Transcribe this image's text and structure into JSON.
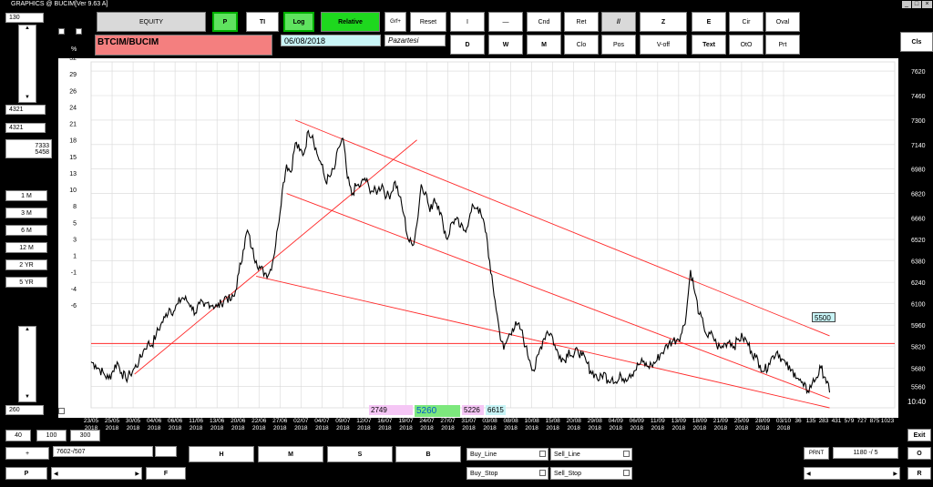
{
  "window": {
    "title": "GRAPHICS  @ BUCIM[Ver 9.63 A]",
    "minimize_glyph": "_",
    "maximize_glyph": "□",
    "close_glyph": "×"
  },
  "toolbar": {
    "equity": "EQUITY",
    "p": "P",
    "ti": "TI",
    "log": "Log",
    "relative": "Relative",
    "grf": "Grf+",
    "reset": "Reset",
    "i": "I",
    "line": "—",
    "cnd": "Cnd",
    "ret": "Ret",
    "parallel": "//",
    "z": "Z",
    "e": "E",
    "cir": "Cir",
    "oval": "Oval",
    "d": "D",
    "w": "W",
    "m": "M",
    "clo": "Clo",
    "pos": "Pos",
    "voff": "V-off",
    "text": "Text",
    "oho": "OtO",
    "prt": "Prt",
    "cls": "Cls"
  },
  "info": {
    "symbol": "BTCIM/BUCIM",
    "date": "06/08/2018",
    "day": "Pazartesi"
  },
  "left_panel": {
    "top_value": "130",
    "field1": "4321",
    "field2": "4321",
    "field3a": "7333",
    "field3b": "5458",
    "ranges": [
      "1 M",
      "3 M",
      "6 M",
      "12 M",
      "2 YR",
      "5 YR"
    ],
    "bottom_value": "260"
  },
  "bottom_controls": {
    "n40": "40",
    "n100": "100",
    "n300": "300",
    "plus": "+",
    "position": "7602-/507",
    "p": "P",
    "f": "F",
    "h": "H",
    "m": "M",
    "s": "S",
    "b": "B",
    "buy_line": "Buy_Line",
    "sell_line": "Sell_Line",
    "buy_stop": "Buy_Stop",
    "sell_stop": "Sell_Stop",
    "prnt": "PRNT",
    "ratio": "1180 -/ 5",
    "exit": "Exit",
    "o": "O",
    "r": "R",
    "time": "10:40"
  },
  "markers": {
    "m1": "2749",
    "m2": "5260",
    "m3": "5226",
    "m4": "6615",
    "price_tag": "5500"
  },
  "colors": {
    "pink_field": "#f47f7f",
    "cyan_field": "#c8f4f6",
    "green_button": "#1ed81e",
    "trend_lines": "#ff2a2a",
    "price_line": "#000000"
  },
  "chart_data": {
    "type": "line",
    "title": "",
    "xlabel": "",
    "ylabel": "",
    "left_axis_label": "%",
    "ylim": [
      5420,
      7680
    ],
    "y_ticks_right": [
      5560,
      5680,
      5820,
      5960,
      6100,
      6240,
      6380,
      6520,
      6660,
      6820,
      6980,
      7140,
      7300,
      7460,
      7620
    ],
    "y_ticks_left": [
      "32",
      "29",
      "26",
      "24",
      "21",
      "18",
      "15",
      "13",
      "10",
      "8",
      "5",
      "3",
      "1",
      "-1",
      "-4",
      "-6"
    ],
    "x_ticks": [
      "23/05 2018",
      "25/05 2018",
      "30/05 2018",
      "04/06 2018",
      "06/06 2018",
      "11/06 2018",
      "13/06 2018",
      "20/06 2018",
      "22/06 2018",
      "27/06 2018",
      "02/07 2018",
      "04/07 2018",
      "09/07 2018",
      "12/07 2018",
      "16/07 2018",
      "19/07 2018",
      "24/07 2018",
      "27/07 2018",
      "31/07 2018",
      "03/08 2018",
      "08/08 2018",
      "10/08 2018",
      "15/08 2018",
      "20/08 2018",
      "29/08 2018",
      "04/09 2018",
      "06/09 2018",
      "11/09 2018",
      "13/09 2018",
      "18/09 2018",
      "21/09 2018",
      "25/09 2018",
      "28/09 2018",
      "03/10 2018"
    ],
    "x_ticks_extra": [
      "36",
      "135",
      "283",
      "431",
      "579",
      "727",
      "875",
      "1023"
    ],
    "grid": true,
    "series": [
      {
        "values": [
          [
            0,
            5720
          ],
          [
            1,
            5700
          ],
          [
            2,
            5670
          ],
          [
            3,
            5640
          ],
          [
            4,
            5610
          ],
          [
            5,
            5660
          ],
          [
            6,
            5720
          ],
          [
            7,
            5650
          ],
          [
            8,
            5610
          ],
          [
            9,
            5640
          ],
          [
            10,
            5680
          ],
          [
            11,
            5720
          ],
          [
            12,
            5790
          ],
          [
            13,
            5840
          ],
          [
            14,
            5830
          ],
          [
            15,
            5900
          ],
          [
            16,
            5960
          ],
          [
            17,
            6010
          ],
          [
            18,
            6070
          ],
          [
            19,
            6050
          ],
          [
            20,
            6100
          ],
          [
            21,
            6140
          ],
          [
            22,
            6120
          ],
          [
            23,
            6090
          ],
          [
            24,
            6040
          ],
          [
            25,
            6100
          ],
          [
            26,
            6080
          ],
          [
            27,
            6110
          ],
          [
            28,
            6090
          ],
          [
            29,
            6080
          ],
          [
            30,
            6100
          ],
          [
            31,
            6150
          ],
          [
            32,
            6120
          ],
          [
            33,
            6150
          ],
          [
            34,
            6300
          ],
          [
            35,
            6450
          ],
          [
            36,
            6580
          ],
          [
            37,
            6460
          ],
          [
            38,
            6380
          ],
          [
            39,
            6330
          ],
          [
            40,
            6300
          ],
          [
            41,
            6300
          ],
          [
            42,
            6400
          ],
          [
            43,
            6600
          ],
          [
            44,
            6840
          ],
          [
            45,
            7010
          ],
          [
            46,
            6960
          ],
          [
            47,
            7150
          ],
          [
            48,
            7100
          ],
          [
            49,
            7080
          ],
          [
            50,
            7230
          ],
          [
            51,
            7200
          ],
          [
            52,
            7080
          ],
          [
            53,
            7010
          ],
          [
            54,
            6900
          ],
          [
            55,
            6930
          ],
          [
            56,
            6980
          ],
          [
            57,
            7120
          ],
          [
            58,
            7180
          ],
          [
            59,
            6920
          ],
          [
            60,
            6810
          ],
          [
            61,
            6870
          ],
          [
            62,
            6870
          ],
          [
            63,
            6920
          ],
          [
            64,
            6860
          ],
          [
            65,
            6830
          ],
          [
            66,
            6840
          ],
          [
            67,
            6880
          ],
          [
            68,
            6800
          ],
          [
            69,
            6820
          ],
          [
            70,
            6900
          ],
          [
            71,
            6800
          ],
          [
            72,
            6680
          ],
          [
            73,
            6520
          ],
          [
            74,
            6480
          ],
          [
            75,
            6620
          ],
          [
            76,
            6880
          ],
          [
            77,
            6830
          ],
          [
            78,
            6700
          ],
          [
            79,
            6790
          ],
          [
            80,
            6740
          ],
          [
            81,
            6620
          ],
          [
            82,
            6520
          ],
          [
            83,
            6630
          ],
          [
            84,
            6650
          ],
          [
            85,
            6600
          ],
          [
            86,
            6580
          ],
          [
            87,
            6650
          ],
          [
            88,
            6740
          ],
          [
            89,
            6730
          ],
          [
            90,
            6660
          ],
          [
            91,
            6560
          ],
          [
            92,
            6300
          ],
          [
            93,
            6120
          ],
          [
            94,
            5920
          ],
          [
            95,
            5800
          ],
          [
            96,
            5880
          ],
          [
            97,
            5940
          ],
          [
            98,
            5960
          ],
          [
            99,
            5930
          ],
          [
            100,
            5820
          ],
          [
            101,
            5730
          ],
          [
            102,
            5660
          ],
          [
            103,
            5770
          ],
          [
            104,
            5860
          ],
          [
            105,
            5920
          ],
          [
            106,
            5900
          ],
          [
            107,
            5800
          ],
          [
            108,
            5760
          ],
          [
            109,
            5730
          ],
          [
            110,
            5800
          ],
          [
            111,
            5750
          ],
          [
            112,
            5800
          ],
          [
            113,
            5760
          ],
          [
            114,
            5720
          ],
          [
            115,
            5660
          ],
          [
            116,
            5640
          ],
          [
            117,
            5600
          ],
          [
            118,
            5650
          ],
          [
            119,
            5600
          ],
          [
            120,
            5620
          ],
          [
            121,
            5580
          ],
          [
            122,
            5630
          ],
          [
            123,
            5610
          ],
          [
            124,
            5640
          ],
          [
            125,
            5660
          ],
          [
            126,
            5700
          ],
          [
            127,
            5720
          ],
          [
            128,
            5690
          ],
          [
            129,
            5700
          ],
          [
            130,
            5720
          ],
          [
            131,
            5770
          ],
          [
            132,
            5800
          ],
          [
            133,
            5840
          ],
          [
            134,
            5860
          ],
          [
            135,
            5870
          ],
          [
            136,
            5910
          ],
          [
            137,
            6030
          ],
          [
            138,
            6320
          ],
          [
            139,
            6170
          ],
          [
            140,
            6030
          ],
          [
            141,
            5960
          ],
          [
            142,
            5880
          ],
          [
            143,
            5900
          ],
          [
            144,
            5830
          ],
          [
            145,
            5810
          ],
          [
            146,
            5840
          ],
          [
            147,
            5860
          ],
          [
            148,
            5820
          ],
          [
            149,
            5870
          ],
          [
            150,
            5880
          ],
          [
            151,
            5850
          ],
          [
            152,
            5790
          ],
          [
            153,
            5750
          ],
          [
            154,
            5700
          ],
          [
            155,
            5660
          ],
          [
            156,
            5710
          ],
          [
            157,
            5760
          ],
          [
            158,
            5790
          ],
          [
            159,
            5740
          ],
          [
            160,
            5700
          ],
          [
            161,
            5660
          ],
          [
            162,
            5650
          ],
          [
            163,
            5600
          ],
          [
            164,
            5560
          ],
          [
            165,
            5530
          ],
          [
            166,
            5580
          ],
          [
            167,
            5620
          ],
          [
            168,
            5680
          ],
          [
            169,
            5620
          ],
          [
            170,
            5520
          ]
        ]
      }
    ],
    "annotations": {
      "horizontal_line": 5840,
      "channel_upper": [
        [
          47,
          7300
        ],
        [
          170,
          5890
        ]
      ],
      "channel_middle": [
        [
          45,
          6820
        ],
        [
          170,
          5480
        ]
      ],
      "channel_lower": [
        [
          38,
          6280
        ],
        [
          170,
          5420
        ]
      ],
      "rising_line": [
        [
          10,
          5640
        ],
        [
          75,
          7170
        ]
      ],
      "price_tag_value": 5500
    }
  }
}
